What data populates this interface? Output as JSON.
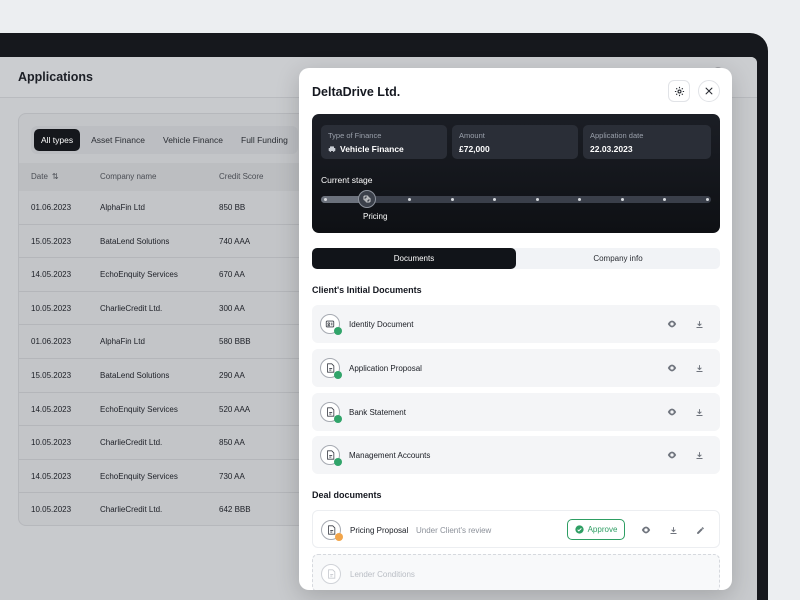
{
  "app": {
    "title": "Applications"
  },
  "filters": [
    "All types",
    "Asset Finance",
    "Vehicle Finance",
    "Full Funding"
  ],
  "table": {
    "columns": [
      "Date",
      "Company name",
      "Credit Score"
    ],
    "rows": [
      [
        "01.06.2023",
        "AlphaFin Ltd",
        "850 BB"
      ],
      [
        "15.05.2023",
        "BataLend Solutions",
        "740 AAA"
      ],
      [
        "14.05.2023",
        "EchoEnquity Services",
        "670 AA"
      ],
      [
        "10.05.2023",
        "CharlieCredit Ltd.",
        "300 AA"
      ],
      [
        "01.06.2023",
        "AlphaFin Ltd",
        "580 BBB"
      ],
      [
        "15.05.2023",
        "BataLend Solutions",
        "290 AA"
      ],
      [
        "14.05.2023",
        "EchoEnquity Services",
        "520 AAA"
      ],
      [
        "10.05.2023",
        "CharlieCredit Ltd.",
        "850 AA"
      ],
      [
        "14.05.2023",
        "EchoEnquity Services",
        "730 AA"
      ],
      [
        "10.05.2023",
        "CharlieCredit Ltd.",
        "642 BBB"
      ]
    ]
  },
  "modal": {
    "title": "DeltaDrive Ltd.",
    "finance": {
      "type_label": "Type of Finance",
      "type_value": "Vehicle Finance",
      "amount_label": "Amount",
      "amount_value": "£72,000",
      "date_label": "Application date",
      "date_value": "22.03.2023"
    },
    "stage": {
      "label": "Current stage",
      "current": "Pricing",
      "current_index": 1,
      "total_steps": 10
    },
    "tabs": [
      "Documents",
      "Company info"
    ],
    "initial_title": "Client's Initial Documents",
    "initial_docs": [
      "Identity Document",
      "Application Proposal",
      "Bank Statement",
      "Management Accounts"
    ],
    "deal_title": "Deal documents",
    "deal_docs": [
      {
        "name": "Pricing Proposal",
        "status": "Under Client's review",
        "action": "Approve"
      },
      {
        "name": "Lender Conditions"
      }
    ]
  },
  "colors": {
    "accent_dark": "#111419",
    "success": "#2e9e63",
    "pending": "#f2a54a"
  }
}
